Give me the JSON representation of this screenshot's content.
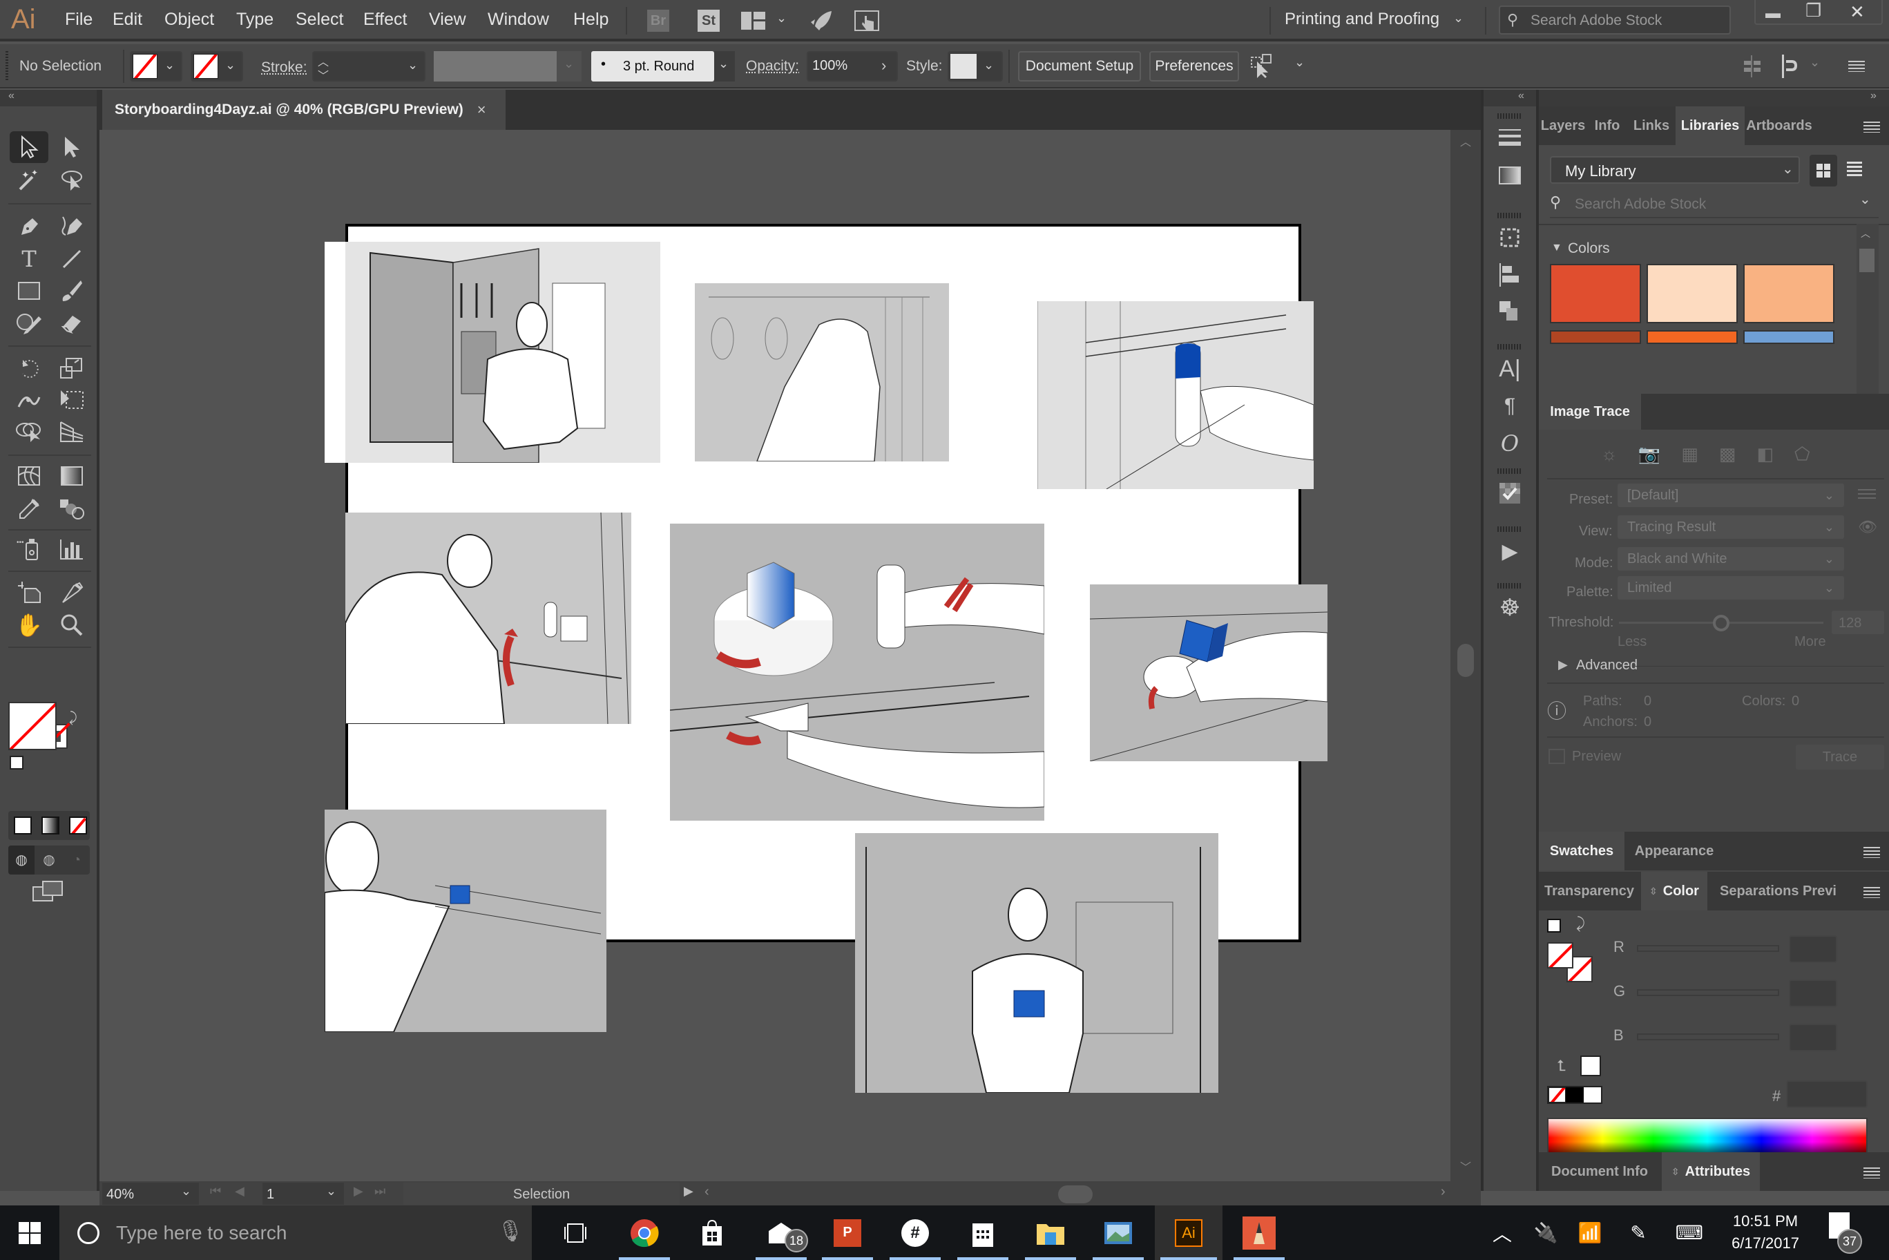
{
  "app": {
    "logo": "Ai",
    "menu": [
      "File",
      "Edit",
      "Object",
      "Type",
      "Select",
      "Effect",
      "View",
      "Window",
      "Help"
    ],
    "bridge_label": "Br",
    "stock_label": "St",
    "workspace": "Printing and Proofing",
    "search_stock_placeholder": "Search Adobe Stock"
  },
  "control_bar": {
    "selection_status": "No Selection",
    "stroke_label": "Stroke:",
    "brush_label": "3 pt. Round",
    "opacity_label": "Opacity:",
    "opacity_value": "100%",
    "style_label": "Style:",
    "document_setup": "Document Setup",
    "preferences": "Preferences"
  },
  "document_tab": {
    "title": "Storyboarding4Dayz.ai @ 40% (RGB/GPU Preview)",
    "close": "×"
  },
  "libraries_panel": {
    "tabs": [
      "Layers",
      "Info",
      "Links",
      "Libraries",
      "Artboards"
    ],
    "active_tab": "Libraries",
    "library": "My Library",
    "search_placeholder": "Search Adobe Stock",
    "section": "Colors",
    "colors": [
      "#E04E2F",
      "#FDDBC0",
      "#F9B282",
      "#B04522",
      "#F26722",
      "#6F9FD5"
    ]
  },
  "image_trace_panel": {
    "title": "Image Trace",
    "preset_label": "Preset:",
    "preset_value": "[Default]",
    "view_label": "View:",
    "view_value": "Tracing Result",
    "mode_label": "Mode:",
    "mode_value": "Black and White",
    "palette_label": "Palette:",
    "palette_value": "Limited",
    "threshold_label": "Threshold:",
    "threshold_value": "128",
    "threshold_fraction": 0.5,
    "less_label": "Less",
    "more_label": "More",
    "advanced_label": "Advanced",
    "paths_label": "Paths:",
    "paths_value": "0",
    "colors_label": "Colors:",
    "colors_value": "0",
    "anchors_label": "Anchors:",
    "anchors_value": "0",
    "preview_label": "Preview",
    "trace_button": "Trace"
  },
  "swatches_group": {
    "tabs": [
      "Swatches",
      "Appearance"
    ]
  },
  "color_group": {
    "tabs": [
      "Transparency",
      "Color",
      "Separations Previ"
    ],
    "active_tab": "Color",
    "channels": [
      "R",
      "G",
      "B"
    ],
    "hex_label": "#"
  },
  "attributes_group": {
    "tabs": [
      "Document Info",
      "Attributes"
    ]
  },
  "status_bar": {
    "zoom": "40%",
    "artboard_number": "1",
    "current_tool": "Selection"
  },
  "taskbar": {
    "search_placeholder": "Type here to search",
    "mail_badge": "18",
    "time": "10:51 PM",
    "date": "6/17/2017",
    "notifications": "37"
  }
}
